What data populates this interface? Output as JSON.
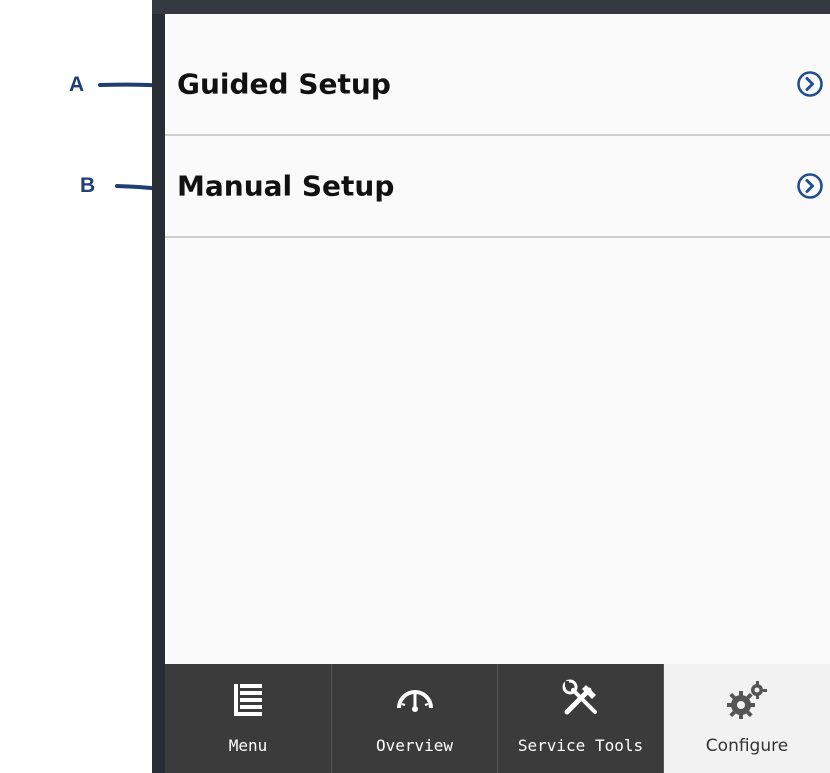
{
  "callouts": [
    {
      "letter": "A"
    },
    {
      "letter": "B"
    }
  ],
  "menu": {
    "items": [
      {
        "label": "Guided Setup"
      },
      {
        "label": "Manual Setup"
      }
    ]
  },
  "nav": {
    "tabs": [
      {
        "label": "Menu",
        "icon": "list-icon",
        "active": false
      },
      {
        "label": "Overview",
        "icon": "gauge-icon",
        "active": false
      },
      {
        "label": "Service Tools",
        "icon": "tools-icon",
        "active": false
      },
      {
        "label": "Configure",
        "icon": "gears-icon",
        "active": true
      }
    ]
  },
  "colors": {
    "callout": "#1f3f73",
    "chevron": "#1f4f8f",
    "nav_bg": "#3b3b3b",
    "nav_active_bg": "#f2f2f2",
    "screen_bg": "#fafafa"
  }
}
